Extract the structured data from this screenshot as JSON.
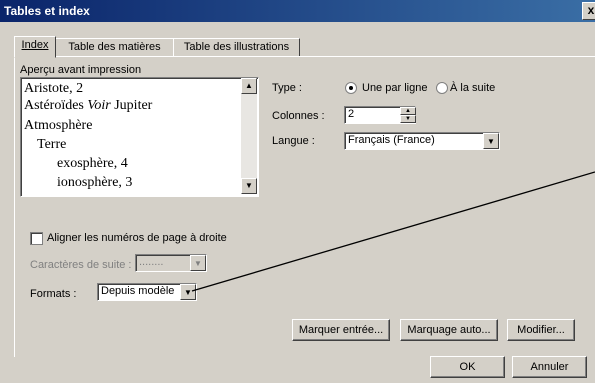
{
  "window": {
    "title": "Tables et index",
    "close_glyph": "x"
  },
  "tabs": [
    {
      "label": "Index",
      "active": true
    },
    {
      "label": "Table des matières",
      "active": false
    },
    {
      "label": "Table des illustrations",
      "active": false
    }
  ],
  "preview": {
    "label": "Aperçu avant impression",
    "lines": [
      {
        "pre": "Aristote, 2",
        "ital": "",
        "post": ""
      },
      {
        "pre": "Astéroïdes ",
        "ital": "Voir",
        "post": " Jupiter"
      },
      {
        "pre": "Atmosphère",
        "ital": "",
        "post": ""
      },
      {
        "pre": "Terre",
        "ital": "",
        "post": ""
      },
      {
        "pre": "exosphère, 4",
        "ital": "",
        "post": ""
      },
      {
        "pre": "ionosphère, 3",
        "ital": "",
        "post": ""
      }
    ]
  },
  "type": {
    "label": "Type :",
    "options": [
      {
        "label": "Une par ligne",
        "selected": true
      },
      {
        "label": "À la suite",
        "selected": false
      }
    ]
  },
  "colonnes": {
    "label": "Colonnes :",
    "value": "2"
  },
  "langue": {
    "label": "Langue :",
    "value": "Français (France)"
  },
  "align_checkbox": {
    "label": "Aligner les numéros de page à droite",
    "checked": false
  },
  "caracteres_suite": {
    "label": "Caractères de suite :",
    "value": "........"
  },
  "formats": {
    "label": "Formats :",
    "value": "Depuis modèle"
  },
  "buttons": {
    "marquer": "Marquer entrée...",
    "marquage_auto": "Marquage auto...",
    "modifier": "Modifier...",
    "ok": "OK",
    "annuler": "Annuler"
  },
  "icons": {
    "scroll_up": "scroll-up-icon",
    "scroll_down": "scroll-down-icon",
    "dropdown": "dropdown-arrow-icon"
  },
  "colors": {
    "title_bar": "#0a246a",
    "dialog_bg": "#d4d0c8"
  }
}
